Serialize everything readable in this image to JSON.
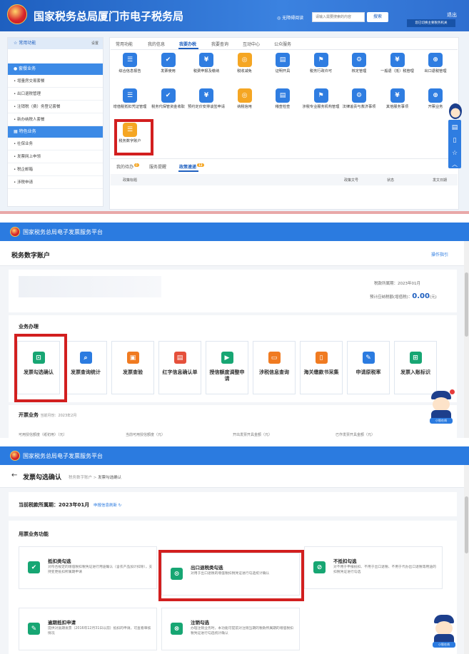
{
  "panel1": {
    "header_title": "国家税务总局厦门市电子税务局",
    "accessibility_link": "无障碍阅读",
    "search_placeholder": "请输入需要搜索的内容",
    "search_button": "搜索",
    "logout": "退出",
    "user_button": "您已切换主要税务机关",
    "sidebar_common_title": "常用功能",
    "sidebar_settings": "设置",
    "sidebar_business_title": "套餐业务",
    "sidebar_business_items": [
      "增量房交易套餐",
      "出口退税管理",
      "注销税（费）务登记套餐",
      "新办纳税人套餐"
    ],
    "sidebar_special_title": "特色业务",
    "sidebar_special_items": [
      "社保业务",
      "发票网上申领",
      "税企邮箱",
      "涉税申请"
    ],
    "tabs": [
      "常用功能",
      "我的信息",
      "我要办税",
      "我要查询",
      "互动中心",
      "公众服务"
    ],
    "services_row1": [
      "综合信息报告",
      "发票使用",
      "税费申报及缴纳",
      "税收减免",
      "证明开具",
      "税务行政许可",
      "核定管理",
      "一般退（抵）税管理",
      "出口退税管理"
    ],
    "services_row2": [
      "增值税抵扣凭证管理",
      "税务代保管资金收取",
      "预约定价安排谈签申请",
      "纳税信用",
      "稽查检查",
      "涉税专业服务机构管理",
      "法律追责与救济事项",
      "其他服务事项",
      "开票业务"
    ],
    "services_row3": [
      "税务数字账户"
    ],
    "lower_tabs": [
      "我的待办",
      "服务提醒",
      "政策速递"
    ],
    "badge_todo": "0",
    "badge_policy": "12",
    "table_headers": [
      "政策标题",
      "政策文号",
      "状态",
      "发文日期"
    ]
  },
  "panel2": {
    "header_title": "国家税务总局电子发票服务平台",
    "page_title": "税务数字账户",
    "help_link": "操作指引",
    "tax_period_label": "税款所属期：",
    "tax_period_value": "2023年01月",
    "estimate_label": "预计应纳税额(增值税)：",
    "estimate_value": "0.00",
    "estimate_unit": "(元)",
    "section_title": "业务办理",
    "tiles": [
      "发票勾选确认",
      "发票查询统计",
      "发票查验",
      "红字信息确认单",
      "授信额度调整申请",
      "涉税信息查询",
      "海关缴款书采集",
      "申请原税率",
      "发票入账标识"
    ],
    "invoicing_title": "开票业务",
    "invoicing_month": "当前月份：2023年2月",
    "invoicing_sub": [
      "可用授信额度（纸初用）（元）",
      "当前可用授信额度（元）",
      "开出发票开具金额（元）",
      "已作发票开具金额（元）"
    ]
  },
  "panel3": {
    "header_title": "国家税务总局电子发票服务平台",
    "page_title": "发票勾选确认",
    "breadcrumb_parent": "税务数字账户",
    "breadcrumb_sep": ">",
    "breadcrumb_current": "发票勾选确认",
    "period_label": "当前税款所属期：2023年01月",
    "refresh_link": "申报信息刷新",
    "section_title": "用票业务功能",
    "cards": [
      {
        "title": "抵扣类勾选",
        "desc": "对符合规定的增值税扣税凭证进行用途确认（含农产品加计扣除），支持变更抵扣所属期申请"
      },
      {
        "title": "出口退税类勾选",
        "desc": "对用于出口退税的增值税扣税凭证进行勾选统计确认"
      },
      {
        "title": "不抵扣勾选",
        "desc": "对不用于申报抵扣、不用于出口退税、不用于代办出口退税等用途的扣税凭证进行勾选"
      },
      {
        "title": "逾期抵扣申请",
        "desc": "提供对逾期发票（2016年12月31日以前）抵扣的申请，可查看审核情况"
      },
      {
        "title": "注销勾选",
        "desc": "办理注销业务时，本功能可提前对注销当期的税款所属期的增值税扣税凭证进行勾选统计确认"
      }
    ]
  },
  "mascot_label": "小智在线"
}
